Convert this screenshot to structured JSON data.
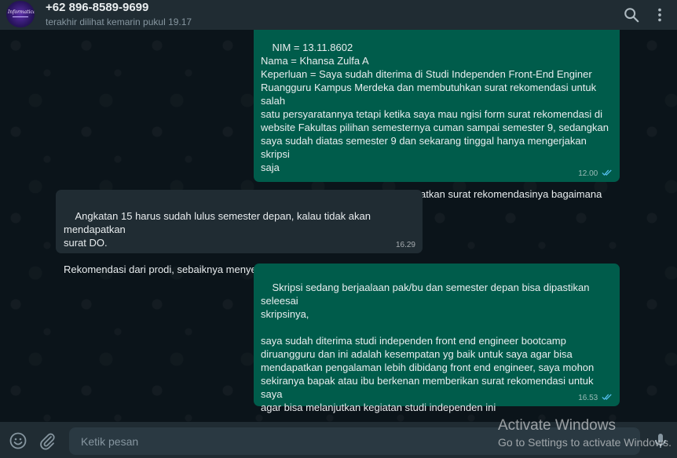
{
  "header": {
    "avatar_text": "Informatica",
    "contact_name": "+62 896-8589-9699",
    "status": "terakhir dilihat kemarin pukul 19.17",
    "icons": [
      "search-icon",
      "menu-icon"
    ]
  },
  "messages": [
    {
      "direction": "outgoing",
      "text": "NIM = 13.11.8602\nNama = Khansa Zulfa A\nKeperluan = Saya sudah diterima di Studi Independen Front-End Enginer\nRuangguru Kampus Merdeka dan membutuhkan surat rekomendasi untuk salah\nsatu persyaratannya tetapi ketika saya mau ngisi form surat rekomendasi di\nwebsite Fakultas pilihan semesternya cuman sampai semester 9, sedangkan\nsaya sudah diatas semester 9 dan sekarang tinggal hanya mengerjakan skripsi\nsaja\n\nMohon informasinya untuk mendapatkan surat rekomendasinya bagaimana ya?\nTerima kasih",
      "time": "12.00",
      "status": "read"
    },
    {
      "direction": "incoming",
      "text": "Angkatan 15 harus sudah lulus semester depan, kalau tidak akan mendapatkan\nsurat DO.\n\nRekomendasi dari prodi, sebaiknya menyelesaikan skripsi.",
      "time": "16.29"
    },
    {
      "direction": "outgoing",
      "text": "Skripsi sedang berjaalaan pak/bu dan semester depan bisa dipastikan seleesai\nskripsinya,\n\nsaya sudah diterima studi independen front end engineer bootcamp\ndiruangguru dan ini adalah kesempatan yg baik untuk saya agar bisa\nmendapatkan pengalaman lebih dibidang front end engineer, saya mohon\nsekiranya bapak atau ibu berkenan memberikan surat rekomendasi untuk saya\nagar bisa melanjutkan kegiatan studi independen ini\n\nTerimakasih",
      "time": "16.53",
      "status": "read"
    }
  ],
  "composer": {
    "placeholder": "Ketik pesan",
    "icons": [
      "emoji-icon",
      "attach-icon",
      "mic-icon"
    ]
  },
  "watermark": {
    "title": "Activate Windows",
    "subtitle": "Go to Settings to activate Windows."
  },
  "colors": {
    "header_bg": "#202c33",
    "chat_bg": "#0b141a",
    "outgoing_bubble": "#005c4b",
    "incoming_bubble": "#202c33",
    "read_ticks": "#53bdeb"
  }
}
